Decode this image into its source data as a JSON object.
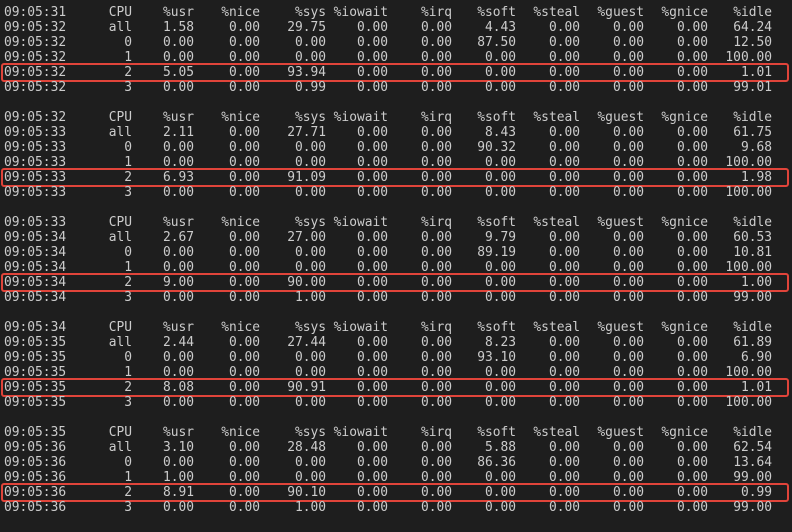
{
  "terminal": {
    "highlight_color": "#e0443a",
    "blocks": [
      {
        "header": [
          "09:05:31",
          "CPU",
          "%usr",
          "%nice",
          "%sys",
          "%iowait",
          "%irq",
          "%soft",
          "%steal",
          "%guest",
          "%gnice",
          "%idle"
        ],
        "rows": [
          [
            "09:05:32",
            "all",
            "1.58",
            "0.00",
            "29.75",
            "0.00",
            "0.00",
            "4.43",
            "0.00",
            "0.00",
            "0.00",
            "64.24"
          ],
          [
            "09:05:32",
            "0",
            "0.00",
            "0.00",
            "0.00",
            "0.00",
            "0.00",
            "87.50",
            "0.00",
            "0.00",
            "0.00",
            "12.50"
          ],
          [
            "09:05:32",
            "1",
            "0.00",
            "0.00",
            "0.00",
            "0.00",
            "0.00",
            "0.00",
            "0.00",
            "0.00",
            "0.00",
            "100.00"
          ],
          [
            "09:05:32",
            "2",
            "5.05",
            "0.00",
            "93.94",
            "0.00",
            "0.00",
            "0.00",
            "0.00",
            "0.00",
            "0.00",
            "1.01"
          ],
          [
            "09:05:32",
            "3",
            "0.00",
            "0.00",
            "0.99",
            "0.00",
            "0.00",
            "0.00",
            "0.00",
            "0.00",
            "0.00",
            "99.01"
          ]
        ]
      },
      {
        "header": [
          "09:05:32",
          "CPU",
          "%usr",
          "%nice",
          "%sys",
          "%iowait",
          "%irq",
          "%soft",
          "%steal",
          "%guest",
          "%gnice",
          "%idle"
        ],
        "rows": [
          [
            "09:05:33",
            "all",
            "2.11",
            "0.00",
            "27.71",
            "0.00",
            "0.00",
            "8.43",
            "0.00",
            "0.00",
            "0.00",
            "61.75"
          ],
          [
            "09:05:33",
            "0",
            "0.00",
            "0.00",
            "0.00",
            "0.00",
            "0.00",
            "90.32",
            "0.00",
            "0.00",
            "0.00",
            "9.68"
          ],
          [
            "09:05:33",
            "1",
            "0.00",
            "0.00",
            "0.00",
            "0.00",
            "0.00",
            "0.00",
            "0.00",
            "0.00",
            "0.00",
            "100.00"
          ],
          [
            "09:05:33",
            "2",
            "6.93",
            "0.00",
            "91.09",
            "0.00",
            "0.00",
            "0.00",
            "0.00",
            "0.00",
            "0.00",
            "1.98"
          ],
          [
            "09:05:33",
            "3",
            "0.00",
            "0.00",
            "0.00",
            "0.00",
            "0.00",
            "0.00",
            "0.00",
            "0.00",
            "0.00",
            "100.00"
          ]
        ]
      },
      {
        "header": [
          "09:05:33",
          "CPU",
          "%usr",
          "%nice",
          "%sys",
          "%iowait",
          "%irq",
          "%soft",
          "%steal",
          "%guest",
          "%gnice",
          "%idle"
        ],
        "rows": [
          [
            "09:05:34",
            "all",
            "2.67",
            "0.00",
            "27.00",
            "0.00",
            "0.00",
            "9.79",
            "0.00",
            "0.00",
            "0.00",
            "60.53"
          ],
          [
            "09:05:34",
            "0",
            "0.00",
            "0.00",
            "0.00",
            "0.00",
            "0.00",
            "89.19",
            "0.00",
            "0.00",
            "0.00",
            "10.81"
          ],
          [
            "09:05:34",
            "1",
            "0.00",
            "0.00",
            "0.00",
            "0.00",
            "0.00",
            "0.00",
            "0.00",
            "0.00",
            "0.00",
            "100.00"
          ],
          [
            "09:05:34",
            "2",
            "9.00",
            "0.00",
            "90.00",
            "0.00",
            "0.00",
            "0.00",
            "0.00",
            "0.00",
            "0.00",
            "1.00"
          ],
          [
            "09:05:34",
            "3",
            "0.00",
            "0.00",
            "1.00",
            "0.00",
            "0.00",
            "0.00",
            "0.00",
            "0.00",
            "0.00",
            "99.00"
          ]
        ]
      },
      {
        "header": [
          "09:05:34",
          "CPU",
          "%usr",
          "%nice",
          "%sys",
          "%iowait",
          "%irq",
          "%soft",
          "%steal",
          "%guest",
          "%gnice",
          "%idle"
        ],
        "rows": [
          [
            "09:05:35",
            "all",
            "2.44",
            "0.00",
            "27.44",
            "0.00",
            "0.00",
            "8.23",
            "0.00",
            "0.00",
            "0.00",
            "61.89"
          ],
          [
            "09:05:35",
            "0",
            "0.00",
            "0.00",
            "0.00",
            "0.00",
            "0.00",
            "93.10",
            "0.00",
            "0.00",
            "0.00",
            "6.90"
          ],
          [
            "09:05:35",
            "1",
            "0.00",
            "0.00",
            "0.00",
            "0.00",
            "0.00",
            "0.00",
            "0.00",
            "0.00",
            "0.00",
            "100.00"
          ],
          [
            "09:05:35",
            "2",
            "8.08",
            "0.00",
            "90.91",
            "0.00",
            "0.00",
            "0.00",
            "0.00",
            "0.00",
            "0.00",
            "1.01"
          ],
          [
            "09:05:35",
            "3",
            "0.00",
            "0.00",
            "0.00",
            "0.00",
            "0.00",
            "0.00",
            "0.00",
            "0.00",
            "0.00",
            "100.00"
          ]
        ]
      },
      {
        "header": [
          "09:05:35",
          "CPU",
          "%usr",
          "%nice",
          "%sys",
          "%iowait",
          "%irq",
          "%soft",
          "%steal",
          "%guest",
          "%gnice",
          "%idle"
        ],
        "rows": [
          [
            "09:05:36",
            "all",
            "3.10",
            "0.00",
            "28.48",
            "0.00",
            "0.00",
            "5.88",
            "0.00",
            "0.00",
            "0.00",
            "62.54"
          ],
          [
            "09:05:36",
            "0",
            "0.00",
            "0.00",
            "0.00",
            "0.00",
            "0.00",
            "86.36",
            "0.00",
            "0.00",
            "0.00",
            "13.64"
          ],
          [
            "09:05:36",
            "1",
            "1.00",
            "0.00",
            "0.00",
            "0.00",
            "0.00",
            "0.00",
            "0.00",
            "0.00",
            "0.00",
            "99.00"
          ],
          [
            "09:05:36",
            "2",
            "8.91",
            "0.00",
            "90.10",
            "0.00",
            "0.00",
            "0.00",
            "0.00",
            "0.00",
            "0.00",
            "0.99"
          ],
          [
            "09:05:36",
            "3",
            "0.00",
            "0.00",
            "1.00",
            "0.00",
            "0.00",
            "0.00",
            "0.00",
            "0.00",
            "0.00",
            "99.00"
          ]
        ]
      }
    ],
    "highlighted_cpu": "2"
  }
}
